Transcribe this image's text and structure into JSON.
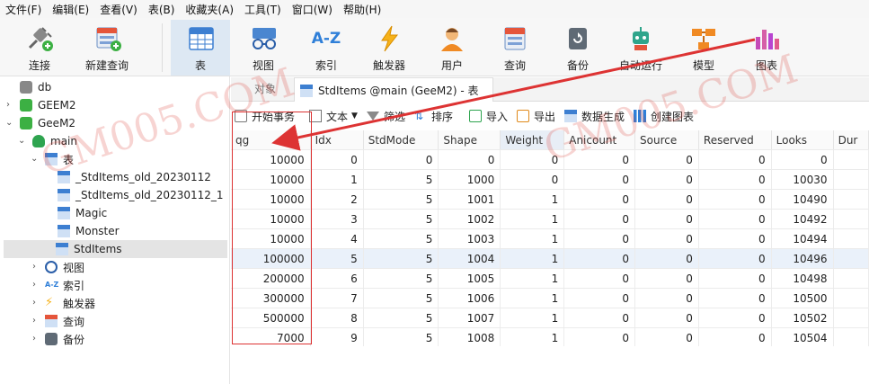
{
  "menubar": [
    "文件(F)",
    "编辑(E)",
    "查看(V)",
    "表(B)",
    "收藏夹(A)",
    "工具(T)",
    "窗口(W)",
    "帮助(H)"
  ],
  "toolbar": {
    "buttons": [
      {
        "label": "连接",
        "icon": "connection-plug-icon"
      },
      {
        "label": "新建查询",
        "icon": "new-query-icon"
      },
      {
        "label": "表",
        "icon": "table-icon",
        "active": true
      },
      {
        "label": "视图",
        "icon": "view-glasses-icon"
      },
      {
        "label": "索引",
        "icon": "index-az-icon"
      },
      {
        "label": "触发器",
        "icon": "trigger-bolt-icon"
      },
      {
        "label": "用户",
        "icon": "user-icon"
      },
      {
        "label": "查询",
        "icon": "query-icon"
      },
      {
        "label": "备份",
        "icon": "backup-icon"
      },
      {
        "label": "自动运行",
        "icon": "robot-icon"
      },
      {
        "label": "模型",
        "icon": "model-icon"
      },
      {
        "label": "图表",
        "icon": "chart-icon"
      }
    ]
  },
  "sidebar": {
    "nodes": [
      {
        "label": "db",
        "icon": "connection-icon"
      },
      {
        "label": "GEEM2",
        "icon": "connection-icon"
      },
      {
        "label": "GeeM2",
        "icon": "connection-icon"
      },
      {
        "label": "main",
        "icon": "database-icon"
      },
      {
        "label": "表",
        "icon": "table-folder-icon"
      },
      {
        "label": "_StdItems_old_20230112",
        "icon": "table-icon"
      },
      {
        "label": "_StdItems_old_20230112_1",
        "icon": "table-icon"
      },
      {
        "label": "Magic",
        "icon": "table-icon"
      },
      {
        "label": "Monster",
        "icon": "table-icon"
      },
      {
        "label": "StdItems",
        "icon": "table-icon",
        "selected": true
      },
      {
        "label": "视图",
        "icon": "view-icon"
      },
      {
        "label": "索引",
        "icon": "index-icon"
      },
      {
        "label": "触发器",
        "icon": "trigger-icon"
      },
      {
        "label": "查询",
        "icon": "query-icon"
      },
      {
        "label": "备份",
        "icon": "backup-icon"
      }
    ]
  },
  "tabs": {
    "objects": "对象",
    "active": "StdItems @main (GeeM2) - 表"
  },
  "subtoolbar": [
    "开始事务",
    "文本",
    "筛选",
    "排序",
    "导入",
    "导出",
    "数据生成",
    "创建图表"
  ],
  "grid": {
    "columns": [
      "qg",
      "Idx",
      "StdMode",
      "Shape",
      "Weight",
      "Anicount",
      "Source",
      "Reserved",
      "Looks",
      "Dur"
    ],
    "rows": [
      [
        "10000",
        "0",
        "0",
        "0",
        "0",
        "0",
        "0",
        "0",
        "0"
      ],
      [
        "10000",
        "1",
        "5",
        "1000",
        "0",
        "0",
        "0",
        "0",
        "10030"
      ],
      [
        "10000",
        "2",
        "5",
        "1001",
        "1",
        "0",
        "0",
        "0",
        "10490"
      ],
      [
        "10000",
        "3",
        "5",
        "1002",
        "1",
        "0",
        "0",
        "0",
        "10492"
      ],
      [
        "10000",
        "4",
        "5",
        "1003",
        "1",
        "0",
        "0",
        "0",
        "10494"
      ],
      [
        "100000",
        "5",
        "5",
        "1004",
        "1",
        "0",
        "0",
        "0",
        "10496"
      ],
      [
        "200000",
        "6",
        "5",
        "1005",
        "1",
        "0",
        "0",
        "0",
        "10498"
      ],
      [
        "300000",
        "7",
        "5",
        "1006",
        "1",
        "0",
        "0",
        "0",
        "10500"
      ],
      [
        "500000",
        "8",
        "5",
        "1007",
        "1",
        "0",
        "0",
        "0",
        "10502"
      ],
      [
        "7000",
        "9",
        "5",
        "1008",
        "1",
        "0",
        "0",
        "0",
        "10504"
      ]
    ]
  },
  "colors": {
    "annotation": "#dd3333",
    "watermark": "#dc3c32",
    "active_toolbar": "#dde8f3"
  }
}
